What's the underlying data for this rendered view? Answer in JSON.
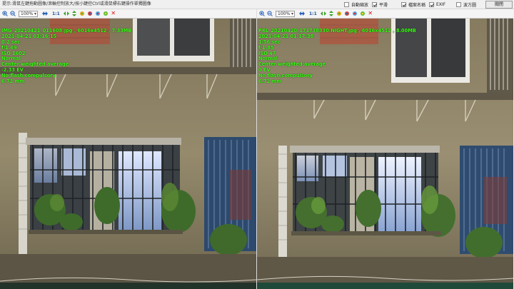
{
  "topbar": {
    "hint": "提示:滑鼠左鍵拖動圖像/滾輪控制放大/按小鍵控Ctrl或滑鼠標右鍵操作單獨圖像",
    "checkboxes": [
      {
        "label": "自動縮放",
        "checked": false
      },
      {
        "label": "平滑",
        "checked": true
      },
      {
        "label": "檔案名稱",
        "checked": true
      },
      {
        "label": "EXIF",
        "checked": true
      },
      {
        "label": "波方圖",
        "checked": false
      }
    ],
    "close_label": "關閉"
  },
  "toolbar": {
    "zoom": "100%",
    "ratio": "1:1",
    "icons": [
      "zoom-in-icon",
      "zoom-out-icon",
      "fit-icon",
      "flip-horizontal-icon",
      "flip-vertical-icon",
      "rotate-left-icon",
      "rotate-right-icon",
      "color-icon",
      "color-icon",
      "close-icon"
    ]
  },
  "left": {
    "exif": [
      "IMG_20210421_011608.jpg , 6016x4512 , 7.33MB",
      "2021-04-21 01:16:15",
      "0.2 sec",
      "f/1.69",
      "ISO 1602",
      "Normal",
      "Center weighted average",
      "-2.33 EV",
      "No flash,compulsory",
      "6.72 mm"
    ]
  },
  "right": {
    "exif": [
      "PXL_20210420_171738330.NIGHT.jpg , 6016x4512 , 8.00MB",
      "2021-04-21 01:17:38",
      "1/56 sec",
      "f/1.85",
      "ISO 47",
      "Normal",
      "Center weighted average",
      "0 EV",
      "No flash,compulsory",
      "6.72 mm"
    ]
  },
  "colors": {
    "exif_text": "#39ff14",
    "wall_left": "#8f8467",
    "wall_right": "#958a6d",
    "brick": "#a15a44",
    "grate": "#2d4a6e",
    "plants": "#3e6b2a",
    "close_red": "#dd1111"
  }
}
